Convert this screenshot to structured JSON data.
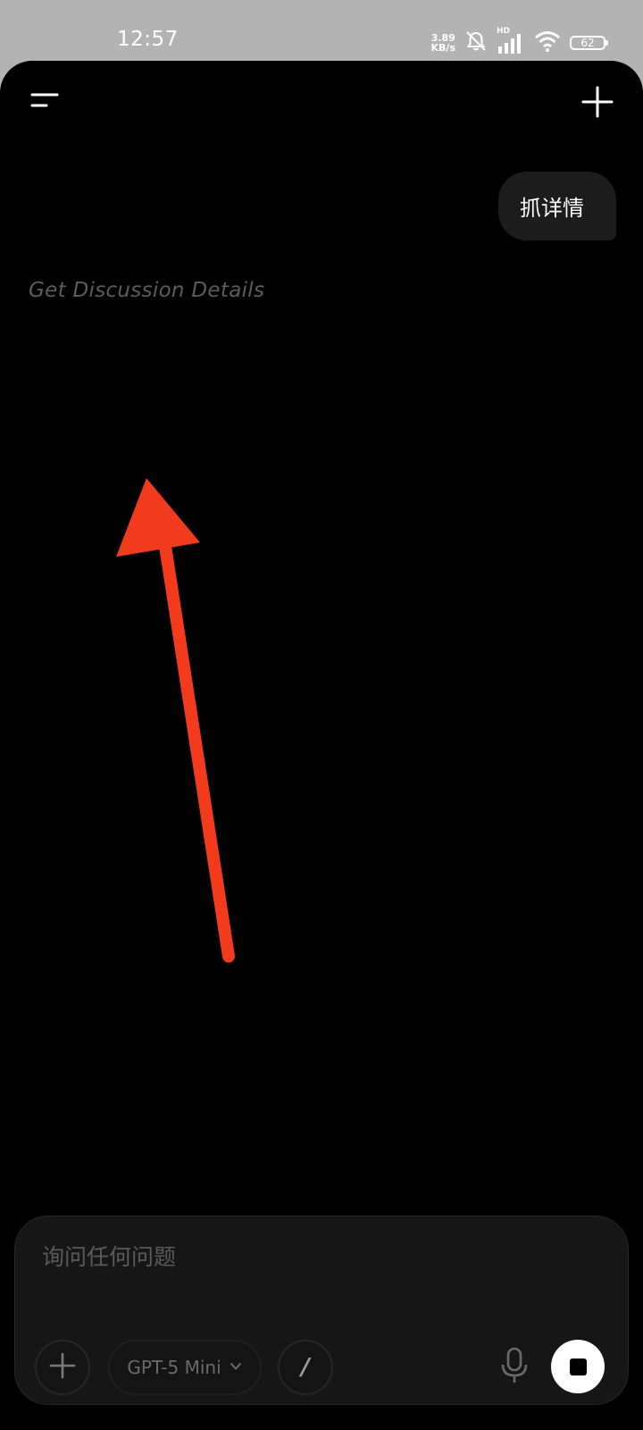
{
  "status_bar": {
    "time": "12:57",
    "net_speed_value": "3.89",
    "net_speed_unit": "KB/s",
    "network_label": "HD",
    "battery": "62"
  },
  "header": {
    "menu_icon": "menu-icon",
    "new_chat_icon": "plus-icon"
  },
  "conversation": {
    "user_message": "抓详情",
    "assistant_status": "Get Discussion Details"
  },
  "annotation": {
    "arrow_color": "#f23a1c"
  },
  "composer": {
    "placeholder": "询问任何问题",
    "value": "",
    "model_label": "GPT-5 Mini",
    "slash_label": "/"
  },
  "colors": {
    "background": "#000000",
    "bubble": "#1c1c1c",
    "composer": "#161616",
    "status_text": "#5c5c5c"
  }
}
